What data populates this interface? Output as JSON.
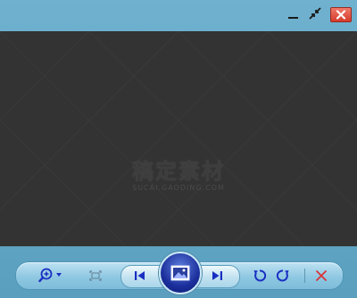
{
  "titlebar": {
    "minimize": "minimize-icon",
    "restore": "restore-icon",
    "close": "close-icon"
  },
  "viewer": {
    "watermark_cn": "稿定素材",
    "watermark_en": "SUCAI.GAODING.COM"
  },
  "toolbar": {
    "zoom": "zoom-in-icon",
    "fit": "fit-to-window-icon",
    "prev": "previous-icon",
    "slideshow": "slideshow-icon",
    "next": "next-icon",
    "rotate_left": "rotate-counterclockwise-icon",
    "rotate_right": "rotate-clockwise-icon",
    "delete": "delete-icon"
  },
  "colors": {
    "frame": "#62a6c4",
    "viewer_bg": "#333333",
    "accent": "#1b2f9c",
    "delete": "#d8343a"
  }
}
